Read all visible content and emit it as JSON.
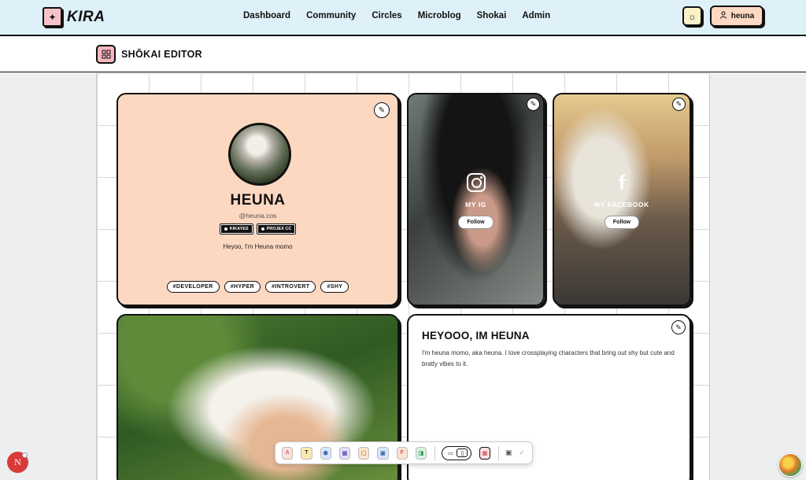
{
  "app": {
    "name": "KIRA"
  },
  "nav": {
    "links": [
      "Dashboard",
      "Community",
      "Circles",
      "Microblog",
      "Shokai",
      "Admin"
    ],
    "user_label": "heuna"
  },
  "editor": {
    "title": "SHŌKAI EDITOR"
  },
  "profile": {
    "name": "HEUNA",
    "handle": "@heuna.cos",
    "badges": [
      "KIKAYES",
      "PROJEX CC"
    ],
    "bio": "Heyoo, I'm Heuna momo",
    "tags": [
      "#DEVELOPER",
      "#HYPER",
      "#INTROVERT",
      "#SHY"
    ]
  },
  "socials": [
    {
      "label": "MY IG",
      "button": "Follow",
      "icon": "instagram-icon"
    },
    {
      "label": "MY FACEBOOK",
      "button": "Follow",
      "icon": "facebook-icon"
    }
  ],
  "text_card": {
    "title": "HEYOOO, IM HEUNA",
    "body": "I'm heuna momo, aka heuna. I love crossplaying characters that bring out shy but cute and bratty vibes to it."
  },
  "toolbar": {
    "tools": [
      {
        "glyph": "A",
        "bg": "#fde1e1",
        "color": "#d66"
      },
      {
        "glyph": "T",
        "bg": "#fbeab0",
        "color": "#333"
      },
      {
        "glyph": "⬢",
        "bg": "#d9e6fb",
        "color": "#4a6fb5"
      },
      {
        "glyph": "▦",
        "bg": "#e3defa",
        "color": "#6b5fb5"
      },
      {
        "glyph": "▢",
        "bg": "#fde6cf",
        "color": "#c98040"
      },
      {
        "glyph": "▣",
        "bg": "#dbe6fb",
        "color": "#4a6fb5"
      },
      {
        "glyph": "F",
        "bg": "#fde0d6",
        "color": "#d2603a"
      },
      {
        "glyph": "◨",
        "bg": "#d7f2e0",
        "color": "#2f9a5a"
      }
    ]
  },
  "colors": {
    "nav_bg": "#dff1f8",
    "profile_bg": "#fdd8c0",
    "accent_pink": "#f7b7bf",
    "user_btn": "#fdd8c3"
  }
}
